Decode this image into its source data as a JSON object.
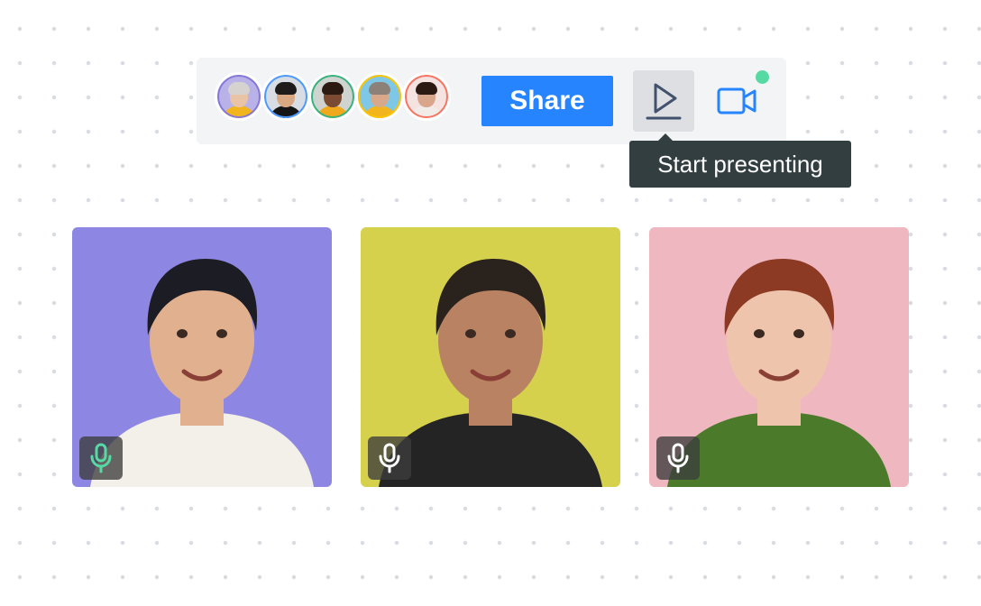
{
  "toolbar": {
    "participants": [
      {
        "name": "participant-1",
        "ring": "#8777d9",
        "bg": "#b9b2e8",
        "skin": "#e9c3a6",
        "hair": "#d6d2cf",
        "shirt": "#f2b51d"
      },
      {
        "name": "participant-2",
        "ring": "#4c9aff",
        "bg": "#d7dde3",
        "skin": "#d9a883",
        "hair": "#1e1b1a",
        "shirt": "#151515"
      },
      {
        "name": "participant-3",
        "ring": "#36b37e",
        "bg": "#cfd4d1",
        "skin": "#7a4a32",
        "hair": "#2a1a12",
        "shirt": "#f0a91c"
      },
      {
        "name": "participant-4",
        "ring": "#ffc400",
        "bg": "#7ec7e6",
        "skin": "#d7a98a",
        "hair": "#8b8178",
        "shirt": "#f2b51d"
      },
      {
        "name": "participant-5",
        "ring": "#f87462",
        "bg": "#f4e3e1",
        "skin": "#d9a68c",
        "hair": "#2c1a12",
        "shirt": "#f1ece8"
      }
    ],
    "share_label": "Share",
    "present_icon": "play-present-icon",
    "camera_icon": "video-camera-icon",
    "camera_status_color": "#57d9a3"
  },
  "tooltip": {
    "text": "Start presenting"
  },
  "tiles": [
    {
      "name": "video-tile-1",
      "bg": "#8e86e3",
      "skin": "#e1b08f",
      "hair": "#1c1c24",
      "shirt": "#f3efe9",
      "mic_icon": "microphone-icon",
      "mic_color": "#57d9a3",
      "speaking": true
    },
    {
      "name": "video-tile-2",
      "bg": "#d6d14d",
      "skin": "#b98363",
      "hair": "#2a221d",
      "shirt": "#242424",
      "mic_icon": "microphone-icon",
      "mic_color": "#ffffff",
      "speaking": false
    },
    {
      "name": "video-tile-3",
      "bg": "#efb8c0",
      "skin": "#efc4ad",
      "hair": "#8c3a24",
      "shirt": "#4b7a2a",
      "mic_icon": "microphone-icon",
      "mic_color": "#ffffff",
      "speaking": false
    }
  ]
}
